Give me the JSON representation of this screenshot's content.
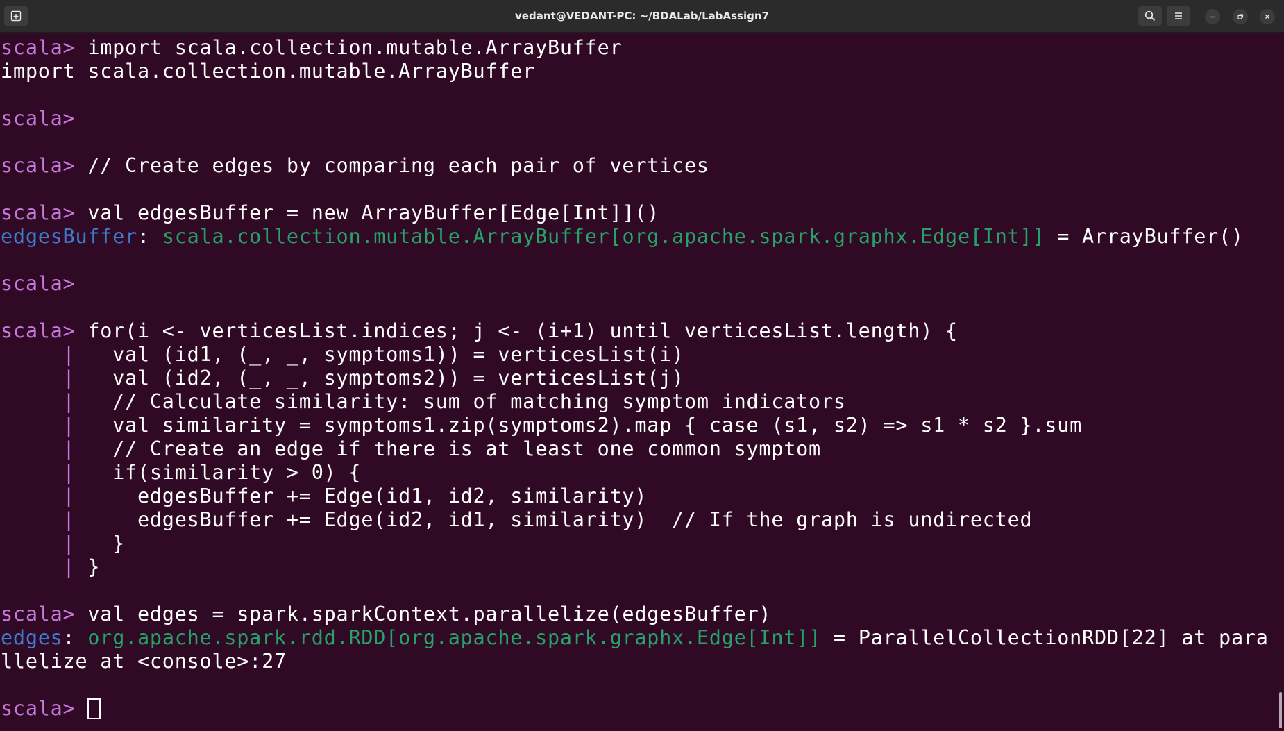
{
  "window": {
    "title": "vedant@VEDANT-PC: ~/BDALab/LabAssign7",
    "icons": {
      "new_tab": "new-tab-icon",
      "search": "search-icon",
      "menu": "hamburger-menu-icon",
      "minimize": "minimize-icon",
      "maximize": "restore-icon",
      "close": "close-icon"
    }
  },
  "terminal": {
    "prompt": "scala> ",
    "lines": [
      {
        "prompt": "scala> ",
        "text": "import scala.collection.mutable.ArrayBuffer"
      },
      {
        "text": "import scala.collection.mutable.ArrayBuffer"
      },
      {
        "text": ""
      },
      {
        "prompt": "scala> ",
        "text": ""
      },
      {
        "text": ""
      },
      {
        "prompt": "scala> ",
        "text": "// Create edges by comparing each pair of vertices"
      },
      {
        "text": ""
      },
      {
        "prompt": "scala> ",
        "text": "val edgesBuffer = new ArrayBuffer[Edge[Int]]()"
      },
      {
        "name": "edgesBuffer",
        "sep": ": ",
        "type": "scala.collection.mutable.ArrayBuffer[org.apache.spark.graphx.Edge[Int]]",
        "rest": " = ArrayBuffer()"
      },
      {
        "text": ""
      },
      {
        "prompt": "scala> ",
        "text": ""
      },
      {
        "text": ""
      },
      {
        "prompt": "scala> ",
        "text": "for(i <- verticesList.indices; j <- (i+1) until verticesList.length) {"
      },
      {
        "cont": "     | ",
        "text": "  val (id1, (_, _, symptoms1)) = verticesList(i)"
      },
      {
        "cont": "     | ",
        "text": "  val (id2, (_, _, symptoms2)) = verticesList(j)"
      },
      {
        "cont": "     | ",
        "text": "  // Calculate similarity: sum of matching symptom indicators"
      },
      {
        "cont": "     | ",
        "text": "  val similarity = symptoms1.zip(symptoms2).map { case (s1, s2) => s1 * s2 }.sum"
      },
      {
        "cont": "     | ",
        "text": "  // Create an edge if there is at least one common symptom"
      },
      {
        "cont": "     | ",
        "text": "  if(similarity > 0) {"
      },
      {
        "cont": "     | ",
        "text": "    edgesBuffer += Edge(id1, id2, similarity)"
      },
      {
        "cont": "     | ",
        "text": "    edgesBuffer += Edge(id2, id1, similarity)  // If the graph is undirected"
      },
      {
        "cont": "     | ",
        "text": "  }"
      },
      {
        "cont": "     | ",
        "text": "}"
      },
      {
        "text": ""
      },
      {
        "prompt": "scala> ",
        "text": "val edges = spark.sparkContext.parallelize(edgesBuffer)"
      },
      {
        "name": "edges",
        "sep": ": ",
        "type": "org.apache.spark.rdd.RDD[org.apache.spark.graphx.Edge[Int]]",
        "rest": " = ParallelCollectionRDD[22] at para"
      },
      {
        "text": "llelize at <console>:27"
      },
      {
        "text": ""
      },
      {
        "prompt": "scala> ",
        "text": "",
        "cursor": true
      }
    ]
  },
  "colors": {
    "background": "#300a24",
    "prompt": "#c678dd",
    "result_name": "#3e7cd1",
    "result_type": "#26a269",
    "text": "#ffffff",
    "titlebar": "#2b2b2b"
  }
}
